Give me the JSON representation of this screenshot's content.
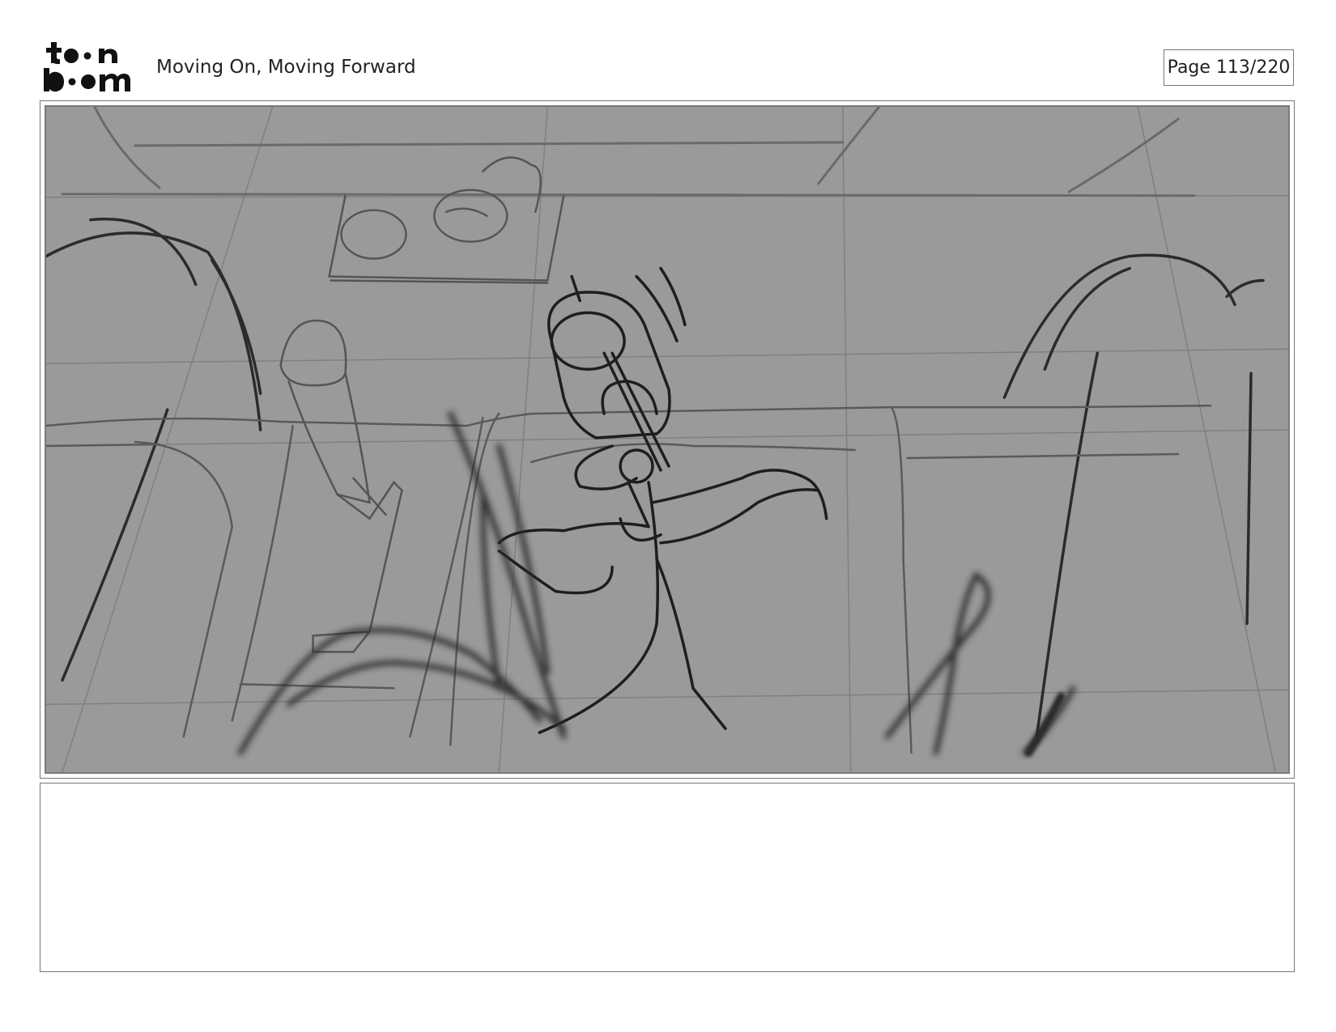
{
  "header": {
    "logo_alt": "toon boom",
    "title": "Moving On, Moving Forward",
    "page_label": "Page 113/220"
  },
  "panel": {
    "background_color": "#9a9a9a",
    "sketch_line_color": "#1e1e1e",
    "guide_line_color": "#7c7c7c"
  },
  "notes": {
    "text": ""
  }
}
